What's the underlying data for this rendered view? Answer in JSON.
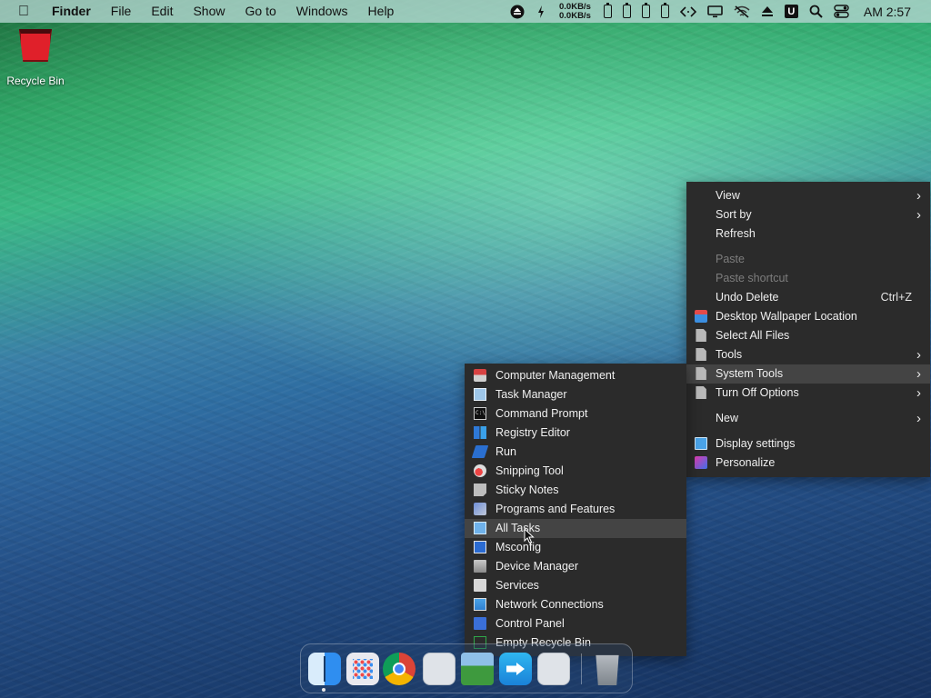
{
  "menubar": {
    "apple_icon": "apple-icon",
    "app_name": "Finder",
    "menus": [
      "File",
      "Edit",
      "Show",
      "Go to",
      "Windows",
      "Help"
    ],
    "status": {
      "net_up": "0.0KB/s",
      "net_down": "0.0KB/s",
      "u_label": "U",
      "clock": "AM 2:57"
    }
  },
  "desktop": {
    "recycle_bin_label": "Recycle Bin"
  },
  "context_menu": {
    "view": "View",
    "sort_by": "Sort by",
    "refresh": "Refresh",
    "paste": "Paste",
    "paste_shortcut": "Paste shortcut",
    "undo_delete": "Undo Delete",
    "undo_shortcut": "Ctrl+Z",
    "wallpaper_location": "Desktop Wallpaper Location",
    "select_all": "Select All Files",
    "tools": "Tools",
    "system_tools": "System Tools",
    "turn_off": "Turn Off Options",
    "new": "New",
    "display_settings": "Display settings",
    "personalize": "Personalize",
    "arrow": "›"
  },
  "system_tools_menu": {
    "items": [
      "Computer Management",
      "Task Manager",
      "Command Prompt",
      "Registry Editor",
      "Run",
      "Snipping Tool",
      "Sticky Notes",
      "Programs and Features",
      "All Tasks",
      "Msconfig",
      "Device Manager",
      "Services",
      "Network Connections",
      "Control Panel",
      "Empty Recycle Bin"
    ],
    "highlighted": "All Tasks",
    "cmd_icon_text": "C:\\"
  },
  "colors": {
    "menu_bg": "#2b2b2b",
    "menu_highlight": "#444444",
    "menu_text": "#f0f0f0",
    "menu_disabled": "#7d7d7d"
  }
}
